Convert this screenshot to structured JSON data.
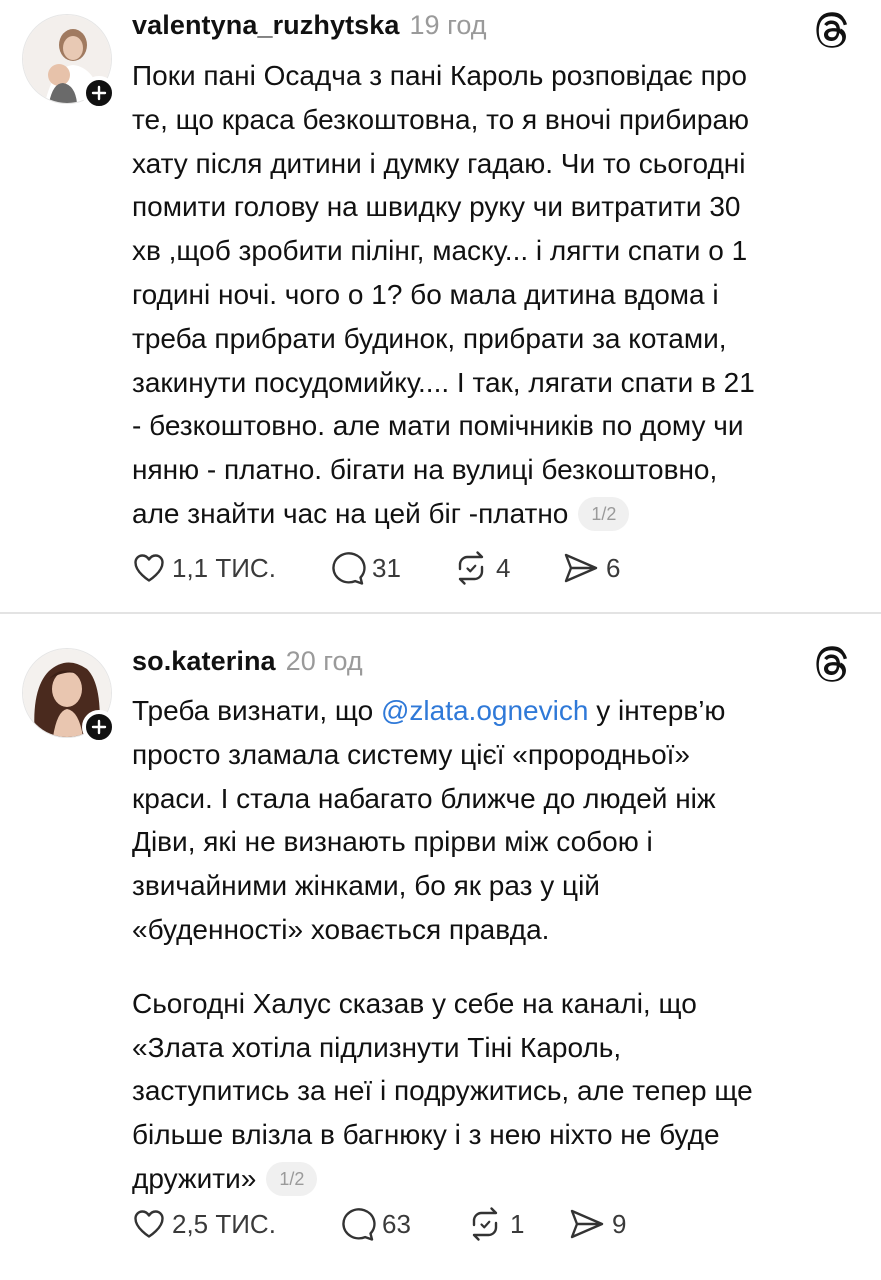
{
  "posts": [
    {
      "username": "valentyna_ruzhytska",
      "time": "19 год",
      "lines": [
        "Поки пані Осадча з пані Кароль розповідає про",
        "те, що краса безкоштовна, то я вночі прибираю",
        "хату після дитини і думку гадаю. Чи то сьогодні",
        "помити голову на швидку руку чи витратити 30",
        "хв ,щоб зробити пілінг, маску... і лягти спати о 1",
        "годині ночі. чого о 1? бо мала дитина вдома і",
        "треба прибрати будинок, прибрати за котами,",
        "закинути посудомийку.... І так, лягати спати в 21",
        "- безкоштовно. але мати помічників по дому чи",
        "няню - платно. бігати на вулиці безкоштовно,",
        "але знайти час на цей біг -платно"
      ],
      "pager": "1/2",
      "likes": "1,1 ТИС.",
      "comments": "31",
      "reposts": "4",
      "shares": "6"
    },
    {
      "username": "so.katerina",
      "time": "20 год",
      "p1_line1_before": "Треба визнати, що ",
      "mention": "@zlata.ognevich",
      "p1_line1_after": " у інтерв’ю",
      "p1_lines": [
        "просто зламала систему цієї «прородньої»",
        "краси. І стала набагато ближче до людей ніж",
        "Діви, які не визнають прірви між собою і",
        "звичайними жінками, бо як раз у цій",
        "«буденності» ховається правда."
      ],
      "p2_lines": [
        "Сьогодні Халус сказав у себе на каналі, що",
        "«Злата хотіла підлизнути Тіні Кароль,",
        "заступитись за неї і подружитись, але тепер ще",
        "більше влізла в багнюку і з нею ніхто не буде",
        "дружити»"
      ],
      "pager": "1/2",
      "likes": "2,5 ТИС.",
      "comments": "63",
      "reposts": "1",
      "shares": "9"
    }
  ],
  "colors": {
    "text": "#111111",
    "muted": "#9a9a9a",
    "mention": "#2f79d8",
    "divider": "#e3e3e3"
  },
  "icons": [
    "plus-icon",
    "threads-logo-icon",
    "heart-icon",
    "comment-icon",
    "repost-icon",
    "share-icon"
  ]
}
